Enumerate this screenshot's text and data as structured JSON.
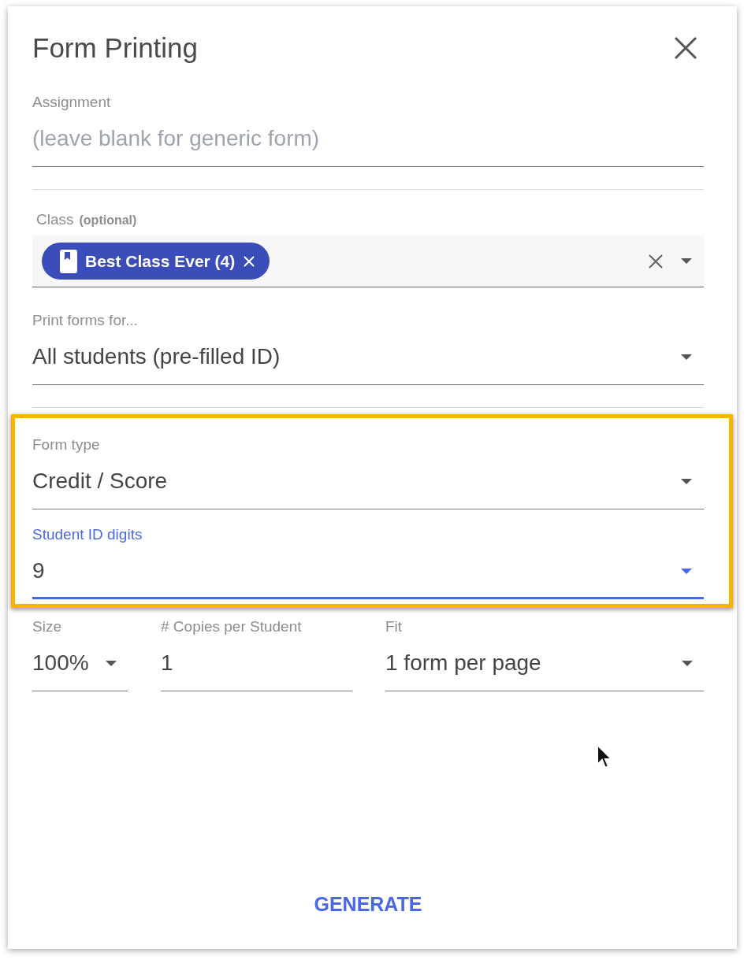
{
  "dialog": {
    "title": "Form Printing"
  },
  "fields": [
    {
      "kind": "input",
      "label": "Assignment",
      "placeholder": "(leave blank for generic form)",
      "focused": false
    },
    {
      "kind": "divider"
    },
    {
      "kind": "chips",
      "label": "Class",
      "hint": "(optional)",
      "chips": [
        {
          "label": "Best Class Ever (4)"
        }
      ]
    },
    {
      "kind": "select",
      "label": "Print forms for...",
      "value": "All students (pre-filled ID)",
      "focused": false
    },
    {
      "kind": "divider"
    },
    {
      "kind": "highlight",
      "fields": [
        {
          "kind": "select",
          "label": "Form type",
          "value": "Credit / Score",
          "focused": false
        },
        {
          "kind": "select",
          "label": "Student ID digits",
          "value": "9",
          "focused": true
        }
      ]
    },
    {
      "kind": "row",
      "fields": [
        {
          "kind": "select",
          "label": "Size",
          "value": "100%",
          "focused": false
        },
        {
          "kind": "input",
          "label": "# Copies per Student",
          "value": "1",
          "focused": false
        },
        {
          "kind": "select",
          "label": "Fit",
          "value": "1 form per page",
          "focused": false
        }
      ]
    }
  ],
  "buttons": [
    {
      "label": "GENERATE"
    }
  ]
}
